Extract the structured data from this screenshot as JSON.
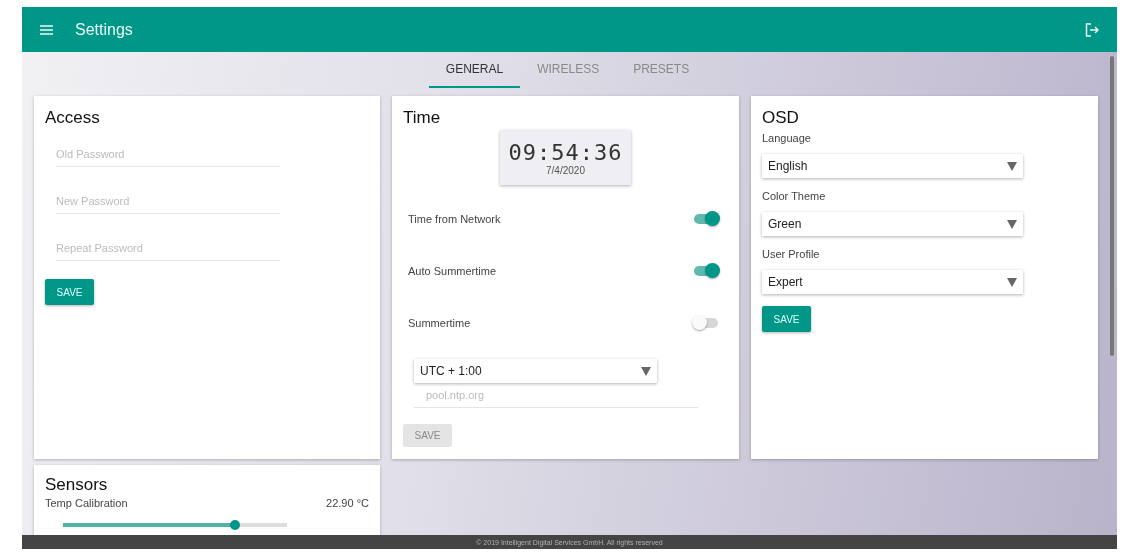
{
  "app_bar": {
    "title": "Settings"
  },
  "tabs": [
    {
      "label": "GENERAL",
      "selected": true
    },
    {
      "label": "WIRELESS",
      "selected": false
    },
    {
      "label": "PRESETS",
      "selected": false
    }
  ],
  "access": {
    "title": "Access",
    "fields": [
      {
        "placeholder": "Old Password"
      },
      {
        "placeholder": "New Password"
      },
      {
        "placeholder": "Repeat Password"
      }
    ],
    "save": {
      "label": "SAVE",
      "disabled": false
    }
  },
  "time": {
    "title": "Time",
    "clock": "09:54:36",
    "date": "7/4/2020",
    "switches": [
      {
        "label": "Time from Network",
        "on": true
      },
      {
        "label": "Auto Summertime",
        "on": true
      },
      {
        "label": "Summertime",
        "on": false
      }
    ],
    "timezone": "UTC + 1:00",
    "ntp_server": {
      "placeholder": "pool.ntp.org"
    },
    "save": {
      "label": "SAVE",
      "disabled": true
    }
  },
  "osd": {
    "title": "OSD",
    "selects": [
      {
        "label": "Language",
        "value": "English"
      },
      {
        "label": "Color Theme",
        "value": "Green"
      },
      {
        "label": "User Profile",
        "value": "Expert"
      }
    ],
    "save": {
      "label": "SAVE",
      "disabled": false
    }
  },
  "sensors": {
    "title": "Sensors",
    "label": "Temp Calibration",
    "reading": "22.90 °C",
    "level": 0.77
  },
  "footer": "© 2019 Intelligent Digital Services GmbH. All rights reserved"
}
